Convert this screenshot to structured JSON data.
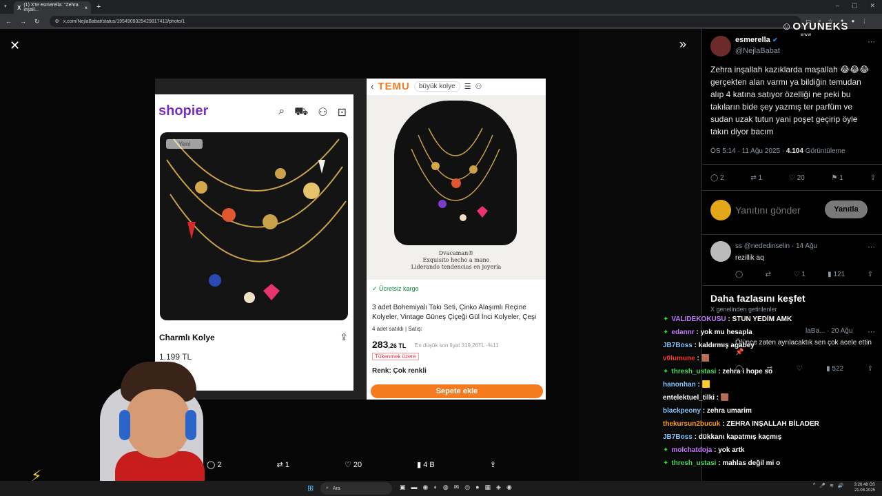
{
  "browser": {
    "tab_title": "(1) X'te esmerella: \"Zehra inşall...",
    "tab_favicon": "X",
    "url": "x.com/NejlaBabat/status/1954909325429817413/photo/1"
  },
  "photo": {
    "shopier": {
      "logo": "shopier",
      "badge": "Yeni",
      "product_name": "Charmlı Kolye",
      "price": "1.199 TL"
    },
    "temu": {
      "logo": "TEMU",
      "search_text": "büyük kolye",
      "brand_line1": "Dvacaman®",
      "brand_line2": "Exquisito hecho a mano",
      "brand_line3": "Liderando tendencias en joyería",
      "free_shipping": "Ücretsiz kargo",
      "description": "3 adet Bohemiyalı Takı Seti, Çinko Alaşımlı Reçine Kolyeler, Vintage Güneş Çiçeği Gül İnci Kolyeler, Çeşi",
      "sold": "4 adet satıldı | Satış:",
      "price_main": "283",
      "price_decimal": ",26 TL",
      "old_price": "En düşük son fiyat 319,26TL",
      "discount": "-%11",
      "stock_tag": "Tükenmek üzere",
      "color": "Renk: Çok renkli",
      "cart_button": "Sepete ekle"
    }
  },
  "bottom_actions": {
    "replies": "2",
    "reposts": "1",
    "likes": "20",
    "views": "4 B"
  },
  "tweet": {
    "author_name": "esmerella",
    "author_handle": "@NejlaBabat",
    "text": "Zehra inşallah kazıklarda maşallah 😂😂😂 gerçekten alan varmı ya bildiğin temudan alıp 4 katına satıyor özelliği ne peki bu takıların bide şey yazmış ter parfüm ve sudan uzak tutun yani poşet geçirip öyle takın diyor bacım",
    "time": "ÖS 5:14 · 11 Ağu 2025 ·",
    "views_count": "4.104",
    "views_label": "Görüntüleme",
    "replies": "2",
    "reposts": "1",
    "likes": "20",
    "bookmarks": "1",
    "reply_placeholder": "Yanıtını gönder",
    "reply_button": "Yanıtla"
  },
  "reply1": {
    "name": "ss",
    "handle": "@nededinselin · 14 Ağu",
    "text": "rezillik aq",
    "likes": "1",
    "views": "121"
  },
  "explore": {
    "title": "Daha fazlasını keşfet",
    "subtitle": "X genelinden getirilenler"
  },
  "reply2": {
    "meta": "laBa... · 20 Ağu",
    "text": "Ölünce zaten ayrılacaktık sen çok acele ettin 📌",
    "views": "522"
  },
  "chat": [
    {
      "user": "VALIDEKOKUSU",
      "msg": "STUN YEDİM AMK",
      "color": "#c77dff",
      "badge": true
    },
    {
      "user": "edannr",
      "msg": "yok mu hesapla",
      "color": "#c77dff",
      "badge": true
    },
    {
      "user": "JB7Boss",
      "msg": "kaldırmış agabey",
      "color": "#7ec8ff",
      "badge": false
    },
    {
      "user": "v0lumune",
      "msg": "🟫",
      "color": "#ff3b3b",
      "badge": false
    },
    {
      "user": "thresh_ustasi",
      "msg": "zehra i hope so",
      "color": "#4cd964",
      "badge": true
    },
    {
      "user": "hanonhan",
      "msg": "🟨",
      "color": "#7ec8ff",
      "badge": false
    },
    {
      "user": "entelektuel_tilki",
      "msg": "🟫",
      "color": "#ffffff",
      "badge": false
    },
    {
      "user": "blackpeony",
      "msg": "zehra umarim",
      "color": "#7ec8ff",
      "badge": false
    },
    {
      "user": "thekursun2bucuk",
      "msg": "ZEHRA INŞALLAH BİLADER",
      "color": "#ff9f1c",
      "badge": false
    },
    {
      "user": "JB7Boss",
      "msg": "dükkanı kapatmış kaçmış",
      "color": "#7ec8ff",
      "badge": false
    },
    {
      "user": "molchatdoja",
      "msg": "yok artk",
      "color": "#c77dff",
      "badge": true
    },
    {
      "user": "thresh_ustasi",
      "msg": "mahlas değil mi o",
      "color": "#4cd964",
      "badge": true
    }
  ],
  "overlay": {
    "logo": "OYUNEKS",
    "logo_sub": "www"
  },
  "taskbar": {
    "search": "Ara",
    "time": "3:26:48 ÖS",
    "date": "21.08.2025"
  }
}
